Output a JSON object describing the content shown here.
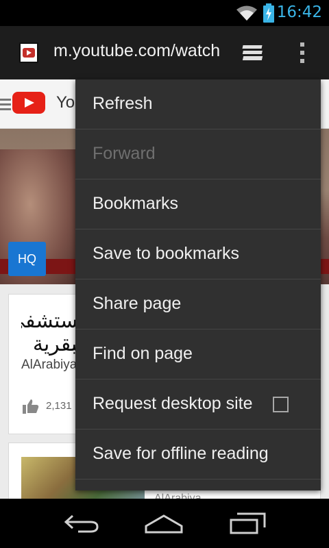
{
  "status_bar": {
    "time": "16:42",
    "icons": [
      "wifi-icon",
      "battery-charging-icon"
    ],
    "accent_color": "#3ab4e6"
  },
  "browser": {
    "url": "m.youtube.com/watch",
    "icons": [
      "youtube-favicon-icon",
      "tabs-icon",
      "overflow-menu-icon"
    ]
  },
  "page": {
    "site_title": "YouTube",
    "hq_badge": "HQ",
    "card1": {
      "title_line1": "مستشفي",
      "title_line2": "عبقرية",
      "channel": "AlArabiya",
      "likes": "2,131"
    },
    "card2": {
      "channel": "AlArabiya"
    }
  },
  "menu": {
    "items": [
      {
        "label": "Refresh",
        "enabled": true
      },
      {
        "label": "Forward",
        "enabled": false
      },
      {
        "label": "Bookmarks",
        "enabled": true
      },
      {
        "label": "Save to bookmarks",
        "enabled": true
      },
      {
        "label": "Share page",
        "enabled": true
      },
      {
        "label": "Find on page",
        "enabled": true
      },
      {
        "label": "Request desktop site",
        "enabled": true,
        "checked": false
      },
      {
        "label": "Save for offline reading",
        "enabled": true
      }
    ]
  },
  "nav_bar": {
    "icons": [
      "back-icon",
      "home-icon",
      "recent-apps-icon"
    ]
  }
}
